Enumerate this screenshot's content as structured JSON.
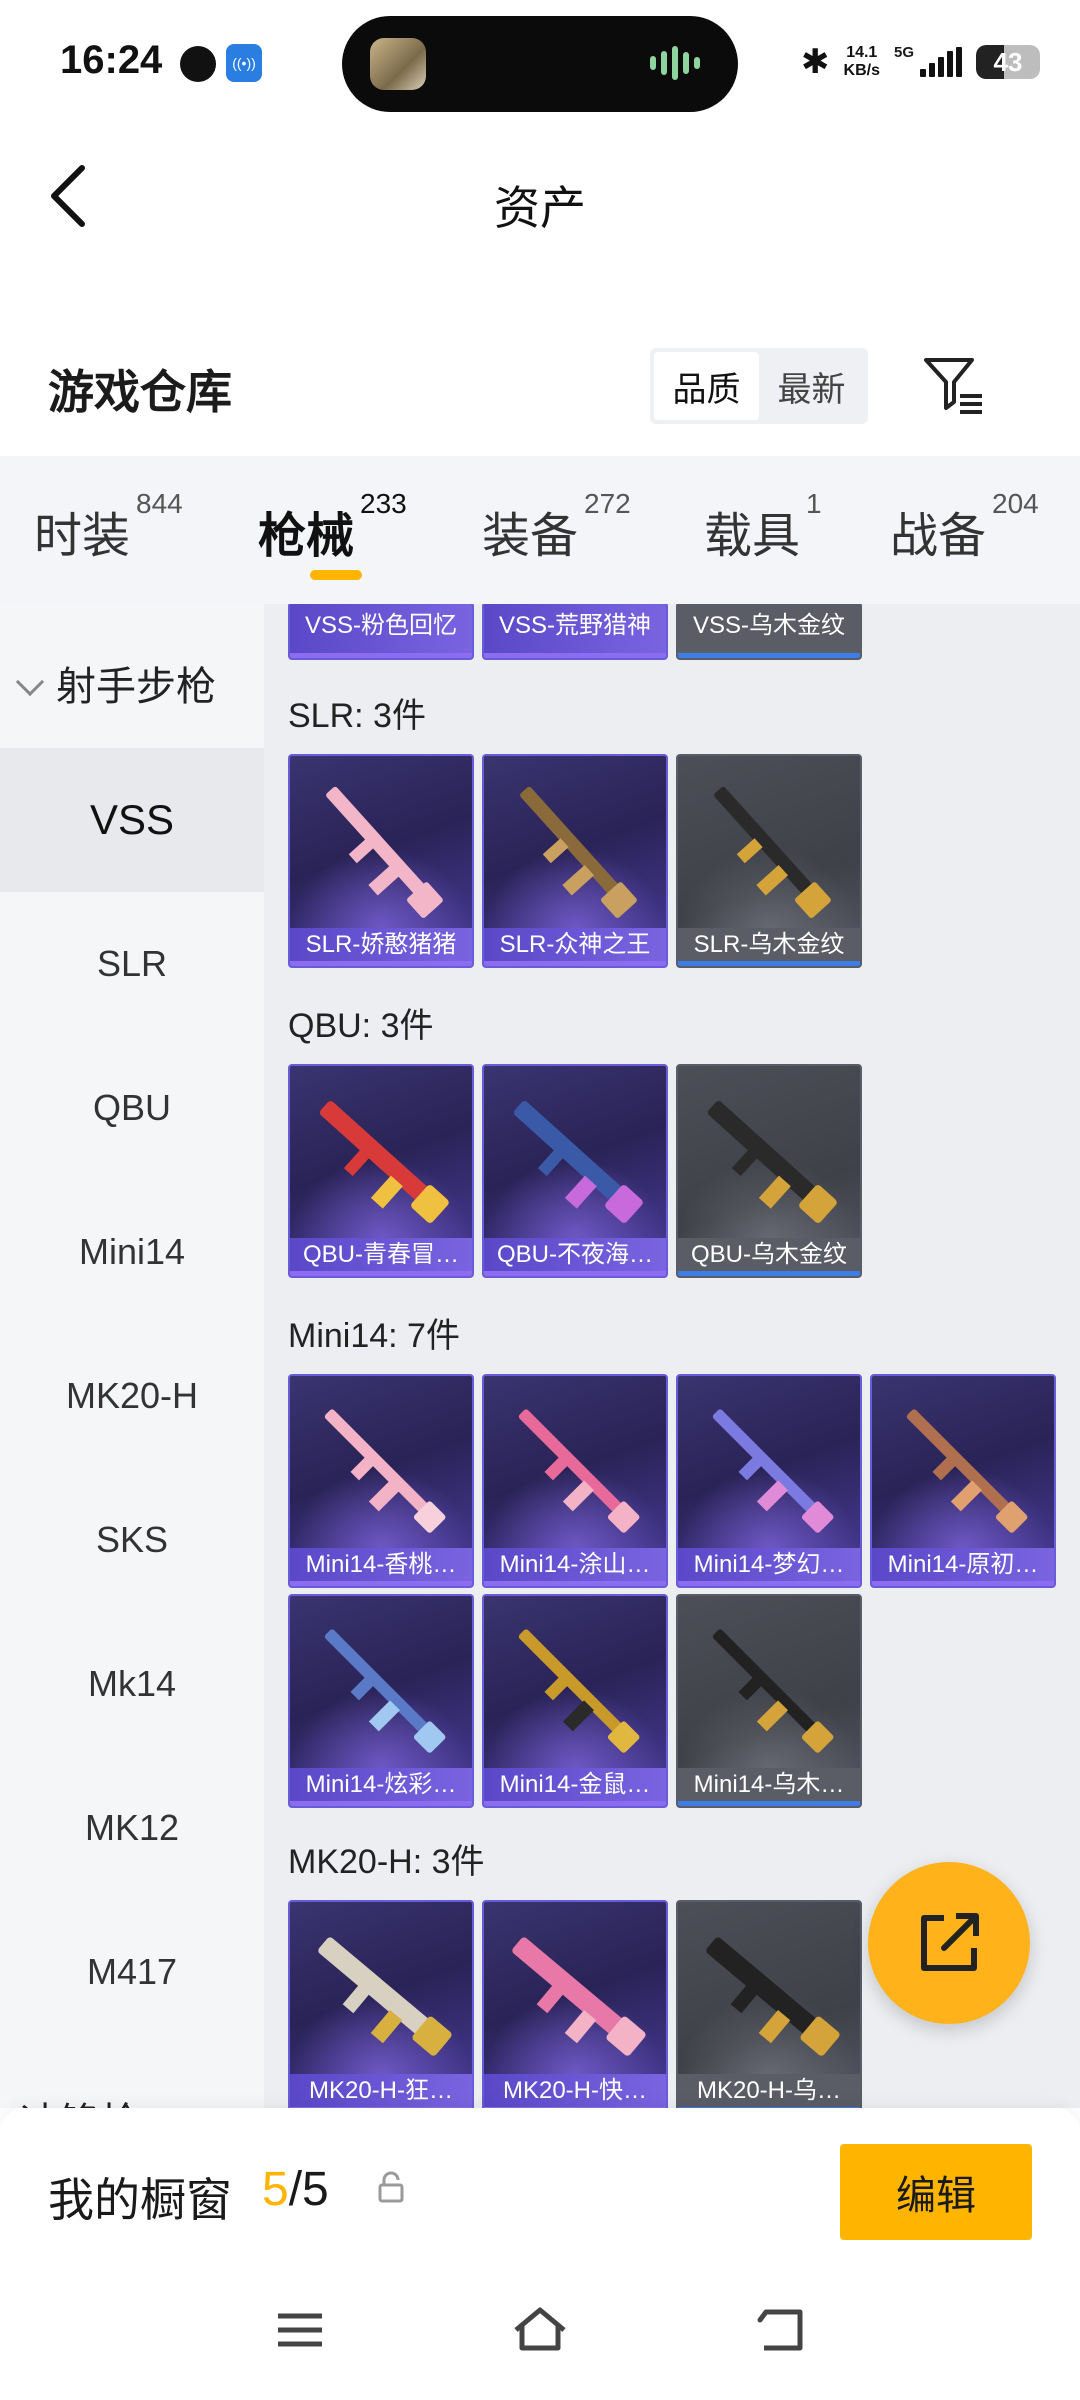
{
  "status_bar": {
    "time": "16:24",
    "app_badge": "((•))",
    "net_speed_value": "14.1",
    "net_speed_unit": "KB/s",
    "network": "5G",
    "battery": "43",
    "battery_level": 0.43
  },
  "header": {
    "title": "资产"
  },
  "section": {
    "title": "游戏仓库",
    "sort_options": [
      "品质",
      "最新"
    ],
    "sort_active": "品质"
  },
  "tabs": [
    {
      "label": "时装",
      "count": "844"
    },
    {
      "label": "枪械",
      "count": "233",
      "active": true
    },
    {
      "label": "装备",
      "count": "272"
    },
    {
      "label": "载具",
      "count": "1"
    },
    {
      "label": "战备",
      "count": "204"
    }
  ],
  "sidebar": {
    "group": "射手步枪",
    "items": [
      "VSS",
      "SLR",
      "QBU",
      "Mini14",
      "MK20-H",
      "SKS",
      "Mk14",
      "MK12",
      "M417"
    ],
    "active": "VSS",
    "next_group_partial": "冲锋枪"
  },
  "content": {
    "vss_row": [
      "VSS-粉色回忆",
      "VSS-荒野猎神",
      "VSS-乌木金纹"
    ],
    "groups": [
      {
        "label": "SLR: 3件",
        "items": [
          "SLR-娇憨猪猪",
          "SLR-众神之王",
          "SLR-乌木金纹"
        ]
      },
      {
        "label": "QBU: 3件",
        "items": [
          "QBU-青春冒…",
          "QBU-不夜海…",
          "QBU-乌木金纹"
        ]
      },
      {
        "label": "Mini14: 7件",
        "items": [
          "Mini14-香桃…",
          "Mini14-涂山…",
          "Mini14-梦幻…",
          "Mini14-原初…",
          "Mini14-炫彩…",
          "Mini14-金鼠…",
          "Mini14-乌木…"
        ]
      },
      {
        "label": "MK20-H: 3件",
        "items": [
          "MK20-H-狂…",
          "MK20-H-快…",
          "MK20-H-乌…"
        ]
      }
    ]
  },
  "bottom": {
    "window_label": "我的橱窗",
    "count_current": "5",
    "count_total": "/5",
    "edit_label": "编辑"
  },
  "colors": {
    "accent": "#ffb400",
    "card_purple": "#3a3470",
    "card_gray": "#4d4f58",
    "indicator_blue": "#3d7ee6"
  }
}
